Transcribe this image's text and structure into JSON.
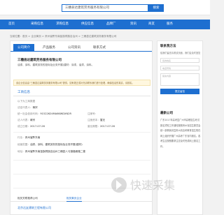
{
  "search": {
    "value": "三穗县达建筑劳务服务有限公司",
    "button": "搜索"
  },
  "nav": {
    "items": [
      "首页",
      "采购信息",
      "求购信息",
      "供应信息",
      "品牌厂",
      "资讯",
      "商友",
      "服务"
    ]
  },
  "breadcrumb": "当前位置：首页 > 企业黄页 > 贵州省黔东南苗族侗族自治州 > 三穗县达建筑劳务服务有限公司",
  "tabs": [
    "公司简介",
    "产品服务",
    "公司资讯",
    "联系方式"
  ],
  "company": {
    "name": "三穗县达建筑劳务服务有限公司",
    "desc": "油漆、涂料、建筑劳务的投标及业务开展(建材：涂漆，油漆，涂料。"
  },
  "notice": "该企业信息由\"三穗县达建筑劳务服务有限公司\"提供，如有更正或补充请联系我们进行处理，确保信息的真实，请核实。",
  "section": {
    "info_title": "工商信息",
    "rows": [
      {
        "k": "以下为工商数据",
        "v": ""
      },
      {
        "k": "法定代表人：",
        "v": "蒋宗"
      },
      {
        "k": "统一社会信用代码：",
        "v": "91522624MA6KWDXN2R"
      },
      {
        "k": "注册号：",
        "v": ""
      },
      {
        "k": "法人代表：",
        "v": "蒋宗"
      },
      {
        "k": "注册资本：",
        "v": "暂无"
      },
      {
        "k": "成立日期：",
        "v": "2017-07-26"
      },
      {
        "k": "营业期限：",
        "v": "2017-07-26"
      },
      {
        "k": "行业：",
        "v": "贵州省黔东南"
      },
      {
        "k": "经营范围：",
        "v": "油漆、涂料、建筑劳务的投标及业务开展(建材)"
      },
      {
        "k": "地址：",
        "v": "贵州省黔东南苗族侗族自治州三穗县八弓镇福缘路二楼"
      }
    ]
  },
  "bottom_tabs": [
    "相关关联推荐公司",
    "相关黄页企业"
  ],
  "related": "北京达友建筑工程有限公司",
  "side": {
    "title": "联系我方法",
    "intro": "给我们留言请看该页面，我们会及时回复",
    "fields": [
      "您的姓名",
      "电话号码",
      "留言内容"
    ],
    "button": "提交留言",
    "news_title": "最新公司",
    "paragraph": "广东2017年高考暨广州市高职招生考试报名须知工作通知按照贵州省招生委员会统一部署我省暨贵州省高考教育招生院在网上组织开展广州高考广东省内报名。各考生应按照要求注意及时完成网上报名工作。"
  },
  "watermark": "快速采集"
}
